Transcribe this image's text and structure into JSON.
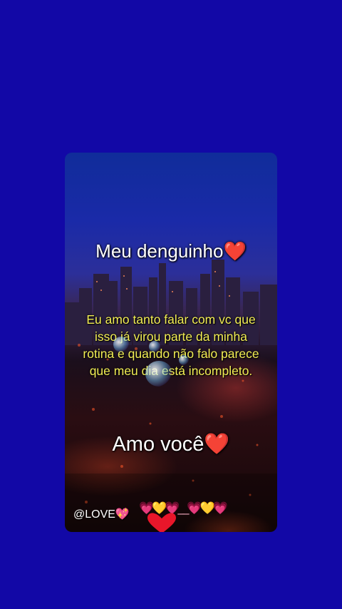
{
  "post": {
    "title": "Meu denguinho",
    "title_emoji": "❤️",
    "message": "Eu amo tanto falar com vc que isso já virou parte da minha rotina e quando não falo parece que meu dia está incompleto.",
    "closing": "Amo você",
    "closing_emoji": "❤️",
    "handle": "@LOVE💖",
    "hearts_row": "💗💛💗__💗💛💗"
  },
  "colors": {
    "background": "#1208a6",
    "message_text": "#f2ed55",
    "title_text": "#ffffff",
    "heart": "#e8162a"
  }
}
